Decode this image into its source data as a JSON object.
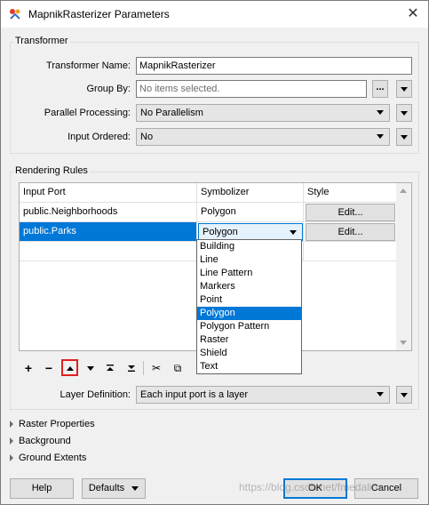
{
  "window": {
    "title": "MapnikRasterizer Parameters",
    "close_glyph": "✕"
  },
  "transformer": {
    "group_label": "Transformer",
    "name_label": "Transformer Name:",
    "name_value": "MapnikRasterizer",
    "group_by_label": "Group By:",
    "group_by_placeholder": "No items selected.",
    "group_by_button": "...",
    "parallel_label": "Parallel Processing:",
    "parallel_value": "No Parallelism",
    "ordered_label": "Input Ordered:",
    "ordered_value": "No"
  },
  "rendering": {
    "group_label": "Rendering Rules",
    "columns": [
      "Input Port",
      "Symbolizer",
      "Style"
    ],
    "rows": [
      {
        "port": "public.Neighborhoods",
        "symbolizer": "Polygon",
        "style": "Edit...",
        "selected": false
      },
      {
        "port": "public.Parks",
        "symbolizer": "Polygon",
        "style": "Edit...",
        "selected": true
      }
    ],
    "dropdown_options": [
      "Building",
      "Line",
      "Line Pattern",
      "Markers",
      "Point",
      "Polygon",
      "Polygon Pattern",
      "Raster",
      "Shield",
      "Text"
    ],
    "dropdown_selected": "Polygon",
    "toolbar": {
      "add": "+",
      "remove": "−",
      "cut": "✂",
      "copy": "⧉"
    },
    "layer_label": "Layer Definition:",
    "layer_value": "Each input port is a layer"
  },
  "sections": {
    "raster": "Raster Properties",
    "background": "Background",
    "ground": "Ground Extents"
  },
  "footer": {
    "help": "Help",
    "defaults": "Defaults",
    "ok": "OK",
    "cancel": "Cancel"
  },
  "watermark": "https://blog.csdn.net/fmedalina",
  "colors": {
    "selection": "#0078d7",
    "highlight_box": "#e02020"
  },
  "icons": {
    "app": "fme-transformer-icon",
    "close": "close-icon"
  }
}
